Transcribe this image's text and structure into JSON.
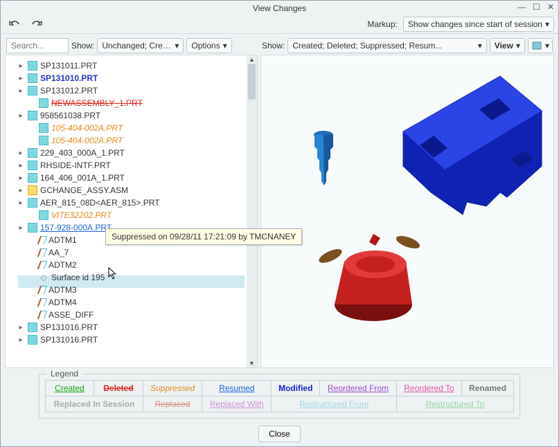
{
  "window": {
    "title": "View Changes"
  },
  "toolbar": {
    "markup_label": "Markup:",
    "markup_value": "Show changes since start of session"
  },
  "left": {
    "search_placeholder": "Search...",
    "show_label": "Show:",
    "show_value": "Unchanged; Create...",
    "options_label": "Options",
    "tree": [
      {
        "label": "SP131011.PRT",
        "arrow": true,
        "icon": "part"
      },
      {
        "label": "SP131010.PRT",
        "arrow": true,
        "icon": "part",
        "cls": "bold-blue"
      },
      {
        "label": "SP131012.PRT",
        "arrow": true,
        "icon": "part"
      },
      {
        "label": "NEWASSEMBLY_1.PRT",
        "arrow": false,
        "icon": "part",
        "cls": "deleted",
        "indent": "indent1"
      },
      {
        "label": "958561038.PRT",
        "arrow": true,
        "icon": "part"
      },
      {
        "label": "105-404-002A.PRT",
        "arrow": false,
        "icon": "part",
        "cls": "suppressed",
        "indent": "indent1"
      },
      {
        "label": "105-404-002A.PRT",
        "arrow": false,
        "icon": "part",
        "cls": "suppressed",
        "indent": "indent1"
      },
      {
        "label": "229_403_000A_1.PRT",
        "arrow": true,
        "icon": "part"
      },
      {
        "label": "RHSIDE-INTF.PRT",
        "arrow": true,
        "icon": "part"
      },
      {
        "label": "164_406_001A_1.PRT",
        "arrow": true,
        "icon": "part"
      },
      {
        "label": "GCHANGE_ASSY.ASM",
        "arrow": true,
        "icon": "asm"
      },
      {
        "label": "AER_815_08D<AER_815>.PRT",
        "arrow": true,
        "icon": "part"
      },
      {
        "label": "VITE32202.PRT",
        "arrow": false,
        "icon": "part",
        "cls": "suppressed",
        "indent": "indent1"
      },
      {
        "label": "157-928-000A.PRT",
        "arrow": true,
        "icon": "part",
        "cls": "resumed"
      },
      {
        "label": "ADTM1",
        "arrow": false,
        "icon": "datum",
        "indent": "indent1"
      },
      {
        "label": "AA_7",
        "arrow": false,
        "icon": "datum",
        "indent": "indent1"
      },
      {
        "label": "ADTM2",
        "arrow": false,
        "icon": "datum",
        "indent": "indent1"
      },
      {
        "label": "Surface id 195",
        "arrow": false,
        "icon": "surf",
        "indent": "indent1"
      },
      {
        "label": "ADTM3",
        "arrow": false,
        "icon": "datum",
        "indent": "indent1"
      },
      {
        "label": "ADTM4",
        "arrow": false,
        "icon": "datum",
        "indent": "indent1"
      },
      {
        "label": "ASSE_DIFF",
        "arrow": false,
        "icon": "datum",
        "indent": "indent1"
      },
      {
        "label": "SP131016.PRT",
        "arrow": true,
        "icon": "part"
      },
      {
        "label": "SP131016.PRT",
        "arrow": true,
        "icon": "part"
      }
    ]
  },
  "right": {
    "show_label": "Show:",
    "show_value": "Created; Deleted; Suppressed; Resum...",
    "view_label": "View"
  },
  "tooltip": "Suppressed on 09/28/11 17:21:09 by TMCNANEY",
  "legend": {
    "title": "Legend",
    "row1": [
      "Created",
      "Deleted",
      "Suppressed",
      "Resumed",
      "Modified",
      "Reordered From",
      "Reordered To",
      "Renamed"
    ],
    "row2": [
      "Replaced In Session",
      "Replaced",
      "Replaced With",
      "Restructured From",
      "",
      "Restructured To",
      ""
    ]
  },
  "footer": {
    "close": "Close"
  }
}
